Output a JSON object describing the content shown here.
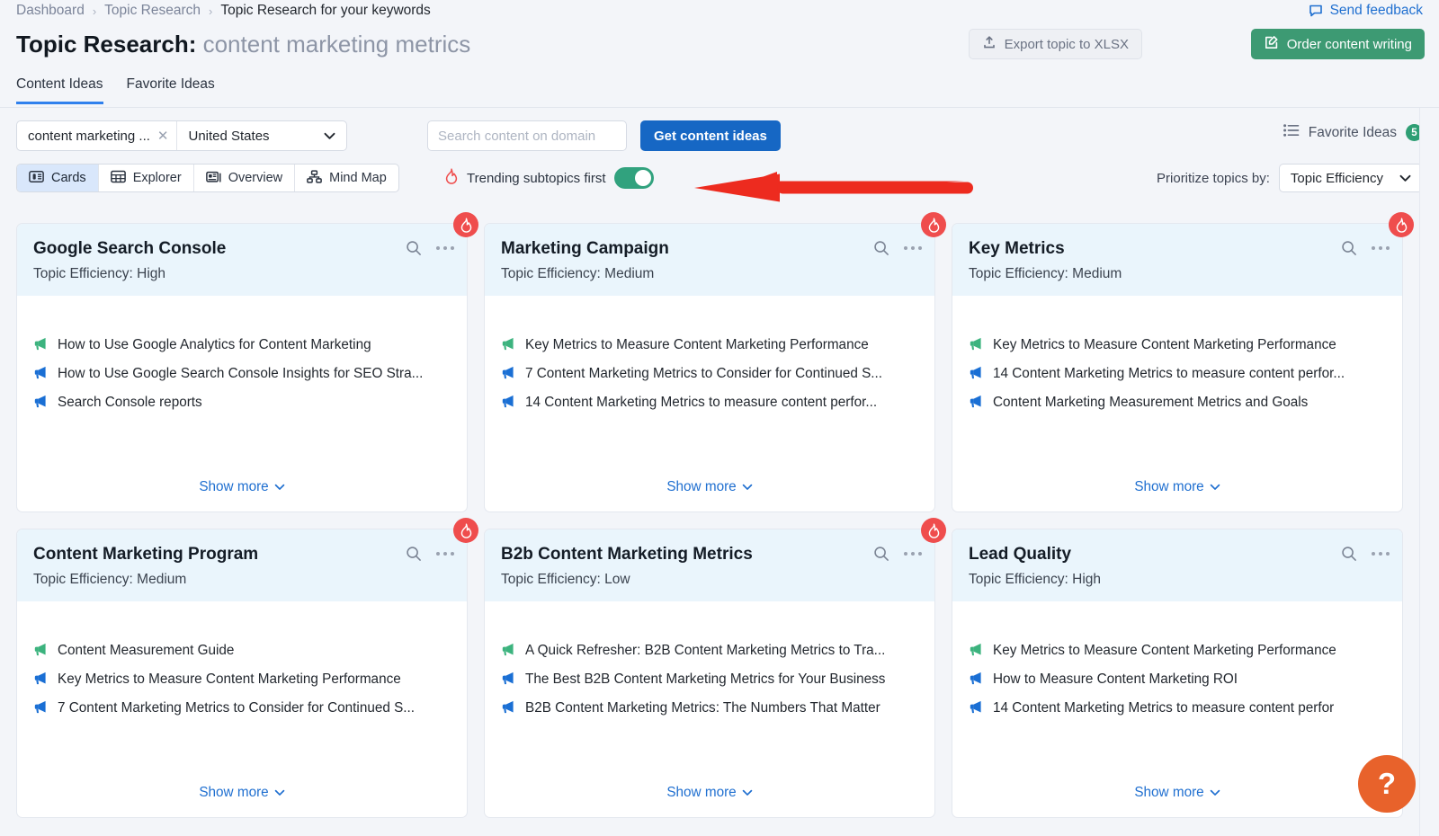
{
  "breadcrumb": {
    "items": [
      "Dashboard",
      "Topic Research",
      "Topic Research for your keywords"
    ],
    "separator": "›"
  },
  "header": {
    "send_feedback": "Send feedback",
    "title_prefix": "Topic Research:",
    "title_keyword": "content marketing metrics",
    "export_label": "Export topic to XLSX",
    "order_label": "Order content writing"
  },
  "tabs": [
    {
      "label": "Content Ideas",
      "active": true
    },
    {
      "label": "Favorite Ideas",
      "active": false
    }
  ],
  "search_bar": {
    "keyword_value": "content marketing ...",
    "clear_glyph": "✕",
    "country_value": "United States",
    "domain_placeholder": "Search content on domain",
    "domain_value": "",
    "get_ideas_label": "Get content ideas",
    "favorite_ideas_label": "Favorite Ideas",
    "favorite_ideas_count": "5"
  },
  "view_modes": [
    {
      "label": "Cards",
      "icon": "cards-icon",
      "active": true
    },
    {
      "label": "Explorer",
      "icon": "table-icon",
      "active": false
    },
    {
      "label": "Overview",
      "icon": "overview-icon",
      "active": false
    },
    {
      "label": "Mind Map",
      "icon": "mindmap-icon",
      "active": false
    }
  ],
  "trending": {
    "label": "Trending subtopics first",
    "enabled": true
  },
  "prioritize": {
    "label": "Prioritize topics by:",
    "value": "Topic Efficiency"
  },
  "show_more_label": "Show more",
  "colors": {
    "accent_blue": "#1667c4",
    "link_blue": "#1f6fd0",
    "green_button": "#3d9a73",
    "fire_red": "#ef4d4d",
    "toggle_green": "#31a27e",
    "badge_green": "#2e9e74",
    "help_orange": "#e8622b",
    "card_header_blue": "#eaf5fc",
    "annotation_red": "#ed2b1f"
  },
  "cards": [
    {
      "title": "Google Search Console",
      "efficiency_label": "Topic Efficiency:",
      "efficiency_value": "High",
      "trending": true,
      "ideas": [
        {
          "text": "How to Use Google Analytics for Content Marketing",
          "color": "green"
        },
        {
          "text": "How to Use Google Search Console Insights for SEO Stra...",
          "color": "blue"
        },
        {
          "text": "Search Console reports",
          "color": "blue"
        }
      ]
    },
    {
      "title": "Marketing Campaign",
      "efficiency_label": "Topic Efficiency:",
      "efficiency_value": "Medium",
      "trending": true,
      "ideas": [
        {
          "text": "Key Metrics to Measure Content Marketing Performance",
          "color": "green"
        },
        {
          "text": "7 Content Marketing Metrics to Consider for Continued S...",
          "color": "blue"
        },
        {
          "text": "14 Content Marketing Metrics to measure content perfor...",
          "color": "blue"
        }
      ]
    },
    {
      "title": "Key Metrics",
      "efficiency_label": "Topic Efficiency:",
      "efficiency_value": "Medium",
      "trending": true,
      "ideas": [
        {
          "text": "Key Metrics to Measure Content Marketing Performance",
          "color": "green"
        },
        {
          "text": "14 Content Marketing Metrics to measure content perfor...",
          "color": "blue"
        },
        {
          "text": "Content Marketing Measurement Metrics and Goals",
          "color": "blue"
        }
      ]
    },
    {
      "title": "Content Marketing Program",
      "efficiency_label": "Topic Efficiency:",
      "efficiency_value": "Medium",
      "trending": true,
      "ideas": [
        {
          "text": "Content Measurement Guide",
          "color": "green"
        },
        {
          "text": "Key Metrics to Measure Content Marketing Performance",
          "color": "blue"
        },
        {
          "text": "7 Content Marketing Metrics to Consider for Continued S...",
          "color": "blue"
        }
      ]
    },
    {
      "title": "B2b Content Marketing Metrics",
      "efficiency_label": "Topic Efficiency:",
      "efficiency_value": "Low",
      "trending": true,
      "ideas": [
        {
          "text": "A Quick Refresher: B2B Content Marketing Metrics to Tra...",
          "color": "green"
        },
        {
          "text": "The Best B2B Content Marketing Metrics for Your Business",
          "color": "blue"
        },
        {
          "text": "B2B Content Marketing Metrics: The Numbers That Matter",
          "color": "blue"
        }
      ]
    },
    {
      "title": "Lead Quality",
      "efficiency_label": "Topic Efficiency:",
      "efficiency_value": "High",
      "trending": false,
      "ideas": [
        {
          "text": "Key Metrics to Measure Content Marketing Performance",
          "color": "green"
        },
        {
          "text": "How to Measure Content Marketing ROI",
          "color": "blue"
        },
        {
          "text": "14 Content Marketing Metrics to measure content perfor",
          "color": "blue"
        }
      ]
    }
  ],
  "help": {
    "glyph": "?"
  }
}
